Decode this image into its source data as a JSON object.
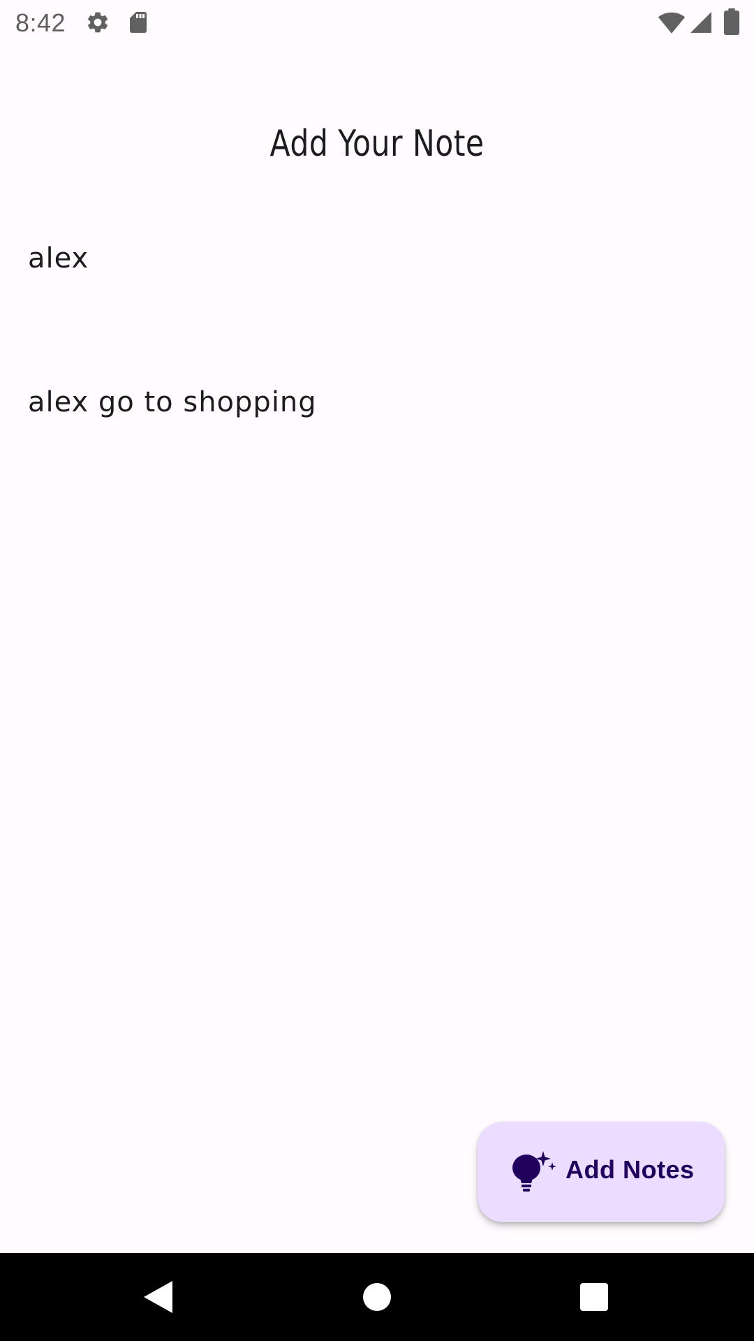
{
  "status_bar": {
    "time": "8:42",
    "icons": [
      "settings-icon",
      "sd-card-icon",
      "wifi-icon",
      "signal-icon",
      "battery-icon"
    ]
  },
  "page": {
    "title": "Add Your Note"
  },
  "notes": [
    {
      "text": "alex"
    },
    {
      "text": "alex go to shopping"
    }
  ],
  "fab": {
    "label": "Add Notes",
    "icon": "lightbulb-sparkle-icon"
  },
  "nav_bar": {
    "buttons": [
      "back-icon",
      "home-icon",
      "recents-icon"
    ]
  },
  "colors": {
    "background": "#FFFBFE",
    "text": "#1C1B1F",
    "fab_background": "#EADDFF",
    "fab_foreground": "#21005D",
    "nav_bar": "#000000"
  }
}
